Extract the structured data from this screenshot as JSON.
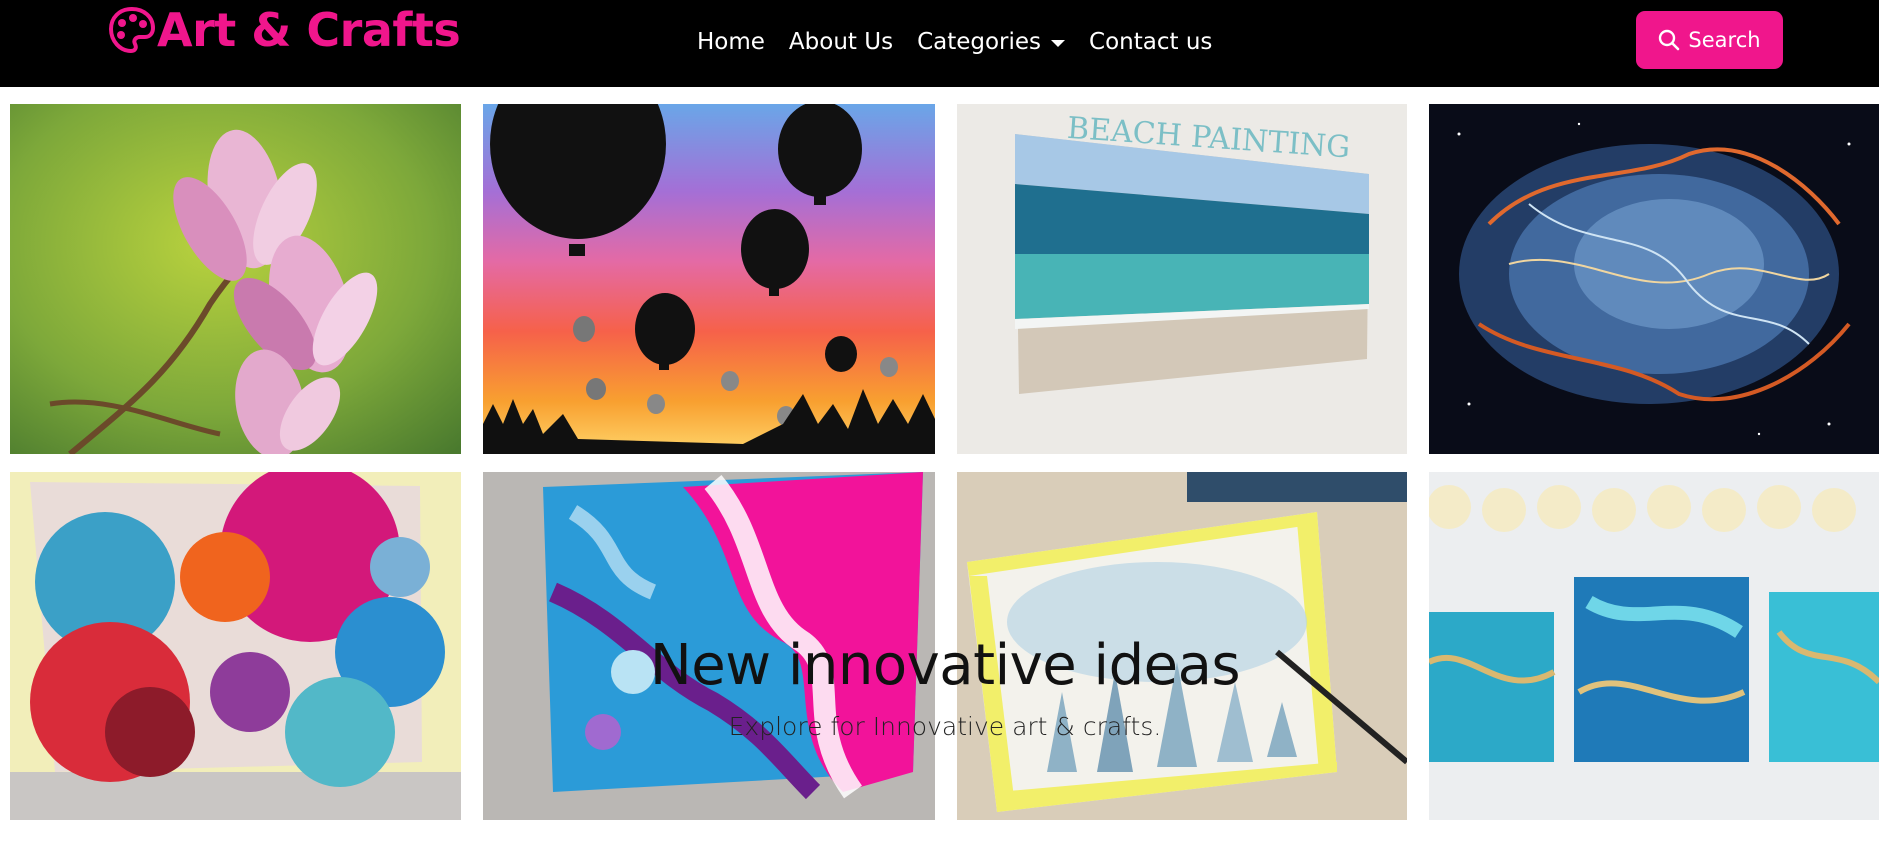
{
  "brand": {
    "title": "Art & Crafts",
    "icon": "palette-icon",
    "color": "#f0168c"
  },
  "nav": {
    "items": [
      {
        "label": "Home"
      },
      {
        "label": "About Us"
      },
      {
        "label": "Categories"
      },
      {
        "label": "Contact us"
      }
    ]
  },
  "search": {
    "label": "Search",
    "icon": "search-icon"
  },
  "gallery": {
    "tiles": [
      {
        "name": "magnolia-painting"
      },
      {
        "name": "hot-air-balloons-painting"
      },
      {
        "name": "beach-painting",
        "text": "BEACH PAINTING"
      },
      {
        "name": "nebula-painting"
      },
      {
        "name": "alcohol-ink-painting"
      },
      {
        "name": "acrylic-pour-painting"
      },
      {
        "name": "watercolor-forest-painting"
      },
      {
        "name": "resin-coasters-painting"
      }
    ]
  },
  "hero": {
    "title": "New innovative ideas",
    "subtitle": "Explore for Innovative art & crafts."
  }
}
